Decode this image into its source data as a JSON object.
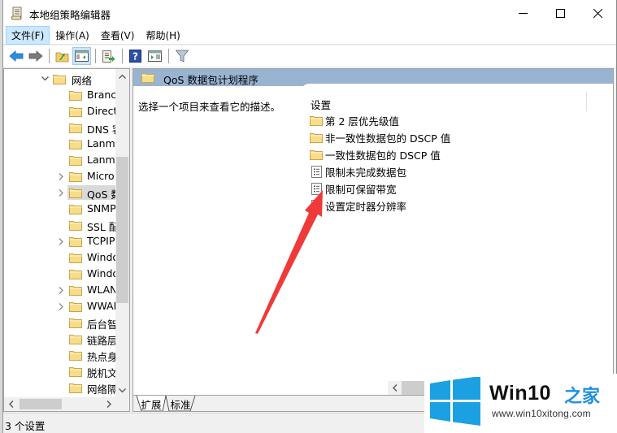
{
  "window": {
    "title": "本地组策略编辑器",
    "controls": {
      "minimize": "minimize",
      "maximize": "maximize",
      "close": "close"
    }
  },
  "menu": [
    {
      "label": "文件(F)",
      "active": true
    },
    {
      "label": "操作(A)",
      "active": false
    },
    {
      "label": "查看(V)",
      "active": false
    },
    {
      "label": "帮助(H)",
      "active": false
    }
  ],
  "toolbar": [
    {
      "name": "back",
      "icon": "arrow-left-icon"
    },
    {
      "name": "forward",
      "icon": "arrow-right-icon"
    },
    {
      "name": "up-folder",
      "icon": "folder-up-icon"
    },
    {
      "name": "show-hide-tree",
      "icon": "console-tree-icon",
      "pressed": true
    },
    {
      "name": "export-list",
      "icon": "export-list-icon"
    },
    {
      "name": "help",
      "icon": "help-icon"
    },
    {
      "name": "show-action-pane",
      "icon": "action-pane-icon"
    },
    {
      "name": "filter",
      "icon": "filter-icon"
    }
  ],
  "tree": {
    "parent": {
      "label": "网络",
      "expanded": true
    },
    "items": [
      {
        "label": "Branch",
        "expandable": false
      },
      {
        "label": "Direct",
        "expandable": false
      },
      {
        "label": "DNS 客",
        "expandable": false
      },
      {
        "label": "Lanma",
        "expandable": false
      },
      {
        "label": "Lanma",
        "expandable": false
      },
      {
        "label": "Micro",
        "expandable": true
      },
      {
        "label": "QoS 数",
        "expandable": true,
        "selected": true
      },
      {
        "label": "SNMP",
        "expandable": false
      },
      {
        "label": "SSL 配",
        "expandable": false
      },
      {
        "label": "TCPIP",
        "expandable": true
      },
      {
        "label": "Windo",
        "expandable": false
      },
      {
        "label": "Windo",
        "expandable": false
      },
      {
        "label": "WLAN",
        "expandable": true
      },
      {
        "label": "WWAN",
        "expandable": true
      },
      {
        "label": "后台智",
        "expandable": false
      },
      {
        "label": "链路层",
        "expandable": false
      },
      {
        "label": "热点身",
        "expandable": false
      },
      {
        "label": "脱机文",
        "expandable": false
      },
      {
        "label": "网络隔",
        "expandable": false
      }
    ]
  },
  "right_pane": {
    "header_title": "QoS 数据包计划程序",
    "description": "选择一个项目来查看它的描述。",
    "column_header": "设置",
    "items": [
      {
        "label": "第 2 层优先级值",
        "type": "folder"
      },
      {
        "label": "非一致性数据包的 DSCP 值",
        "type": "folder"
      },
      {
        "label": "一致性数据包的 DSCP 值",
        "type": "folder"
      },
      {
        "label": "限制未完成数据包",
        "type": "setting"
      },
      {
        "label": "限制可保留带宽",
        "type": "setting"
      },
      {
        "label": "设置定时器分辨率",
        "type": "setting"
      }
    ],
    "tabs": [
      {
        "label": "扩展",
        "active": true
      },
      {
        "label": "标准",
        "active": false
      }
    ]
  },
  "status": {
    "text": "3 个设置"
  },
  "watermark": {
    "brand": "Win10",
    "brand_cn": "之家",
    "url": "www.win10xitong.com",
    "logo_color": "#1ba1e2",
    "brand_cn_color": "#1e90e0"
  },
  "annotation": {
    "type": "arrow",
    "color": "#f03a3a",
    "points_to": "限制可保留带宽"
  }
}
